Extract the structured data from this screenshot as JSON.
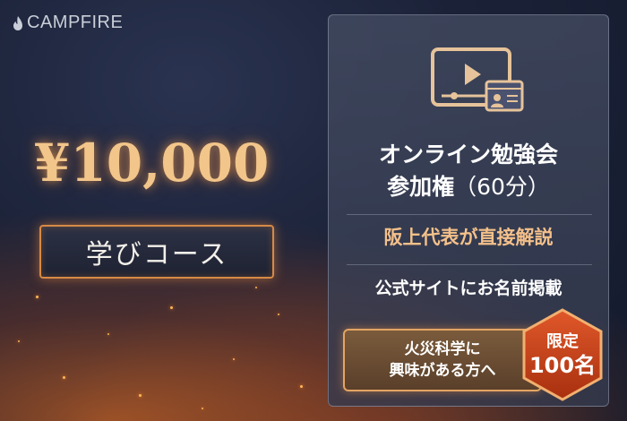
{
  "logo": {
    "text": "CAMPFIRE",
    "icon": "flame-icon"
  },
  "price": "¥10,000",
  "course_label": "学びコース",
  "card": {
    "icon": "video-lesson-icon",
    "title_line1": "オンライン勉強会",
    "title_line2": "参加権",
    "title_suffix": "（60分）",
    "feature_highlight": "阪上代表が直接解説",
    "feature_plain": "公式サイトにお名前掲載",
    "target_line1": "火災科学に",
    "target_line2": "興味がある方へ",
    "limit_line1": "限定",
    "limit_line2": "100名"
  },
  "colors": {
    "accent_gold": "#f2c58a",
    "accent_orange": "#d68a46",
    "badge_red": "#c9401c"
  }
}
